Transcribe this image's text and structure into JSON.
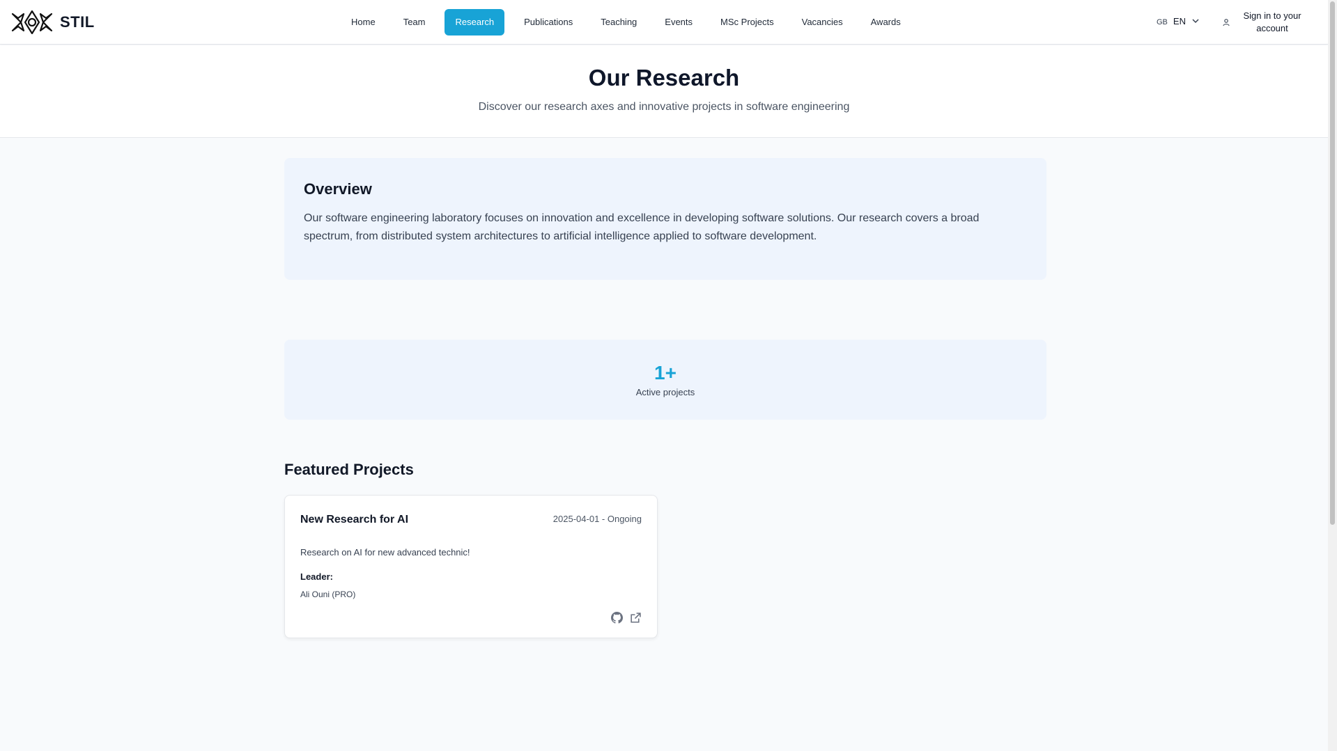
{
  "header": {
    "logo_text": "STIL",
    "nav": [
      {
        "label": "Home"
      },
      {
        "label": "Team"
      },
      {
        "label": "Research"
      },
      {
        "label": "Publications"
      },
      {
        "label": "Teaching"
      },
      {
        "label": "Events"
      },
      {
        "label": "MSc Projects"
      },
      {
        "label": "Vacancies"
      },
      {
        "label": "Awards"
      }
    ],
    "active_nav": "Research",
    "language": {
      "flag": "GB",
      "code": "EN"
    },
    "signin_label": "Sign in to your account"
  },
  "hero": {
    "title": "Our Research",
    "subtitle": "Discover our research axes and innovative projects in software engineering"
  },
  "overview": {
    "title": "Overview",
    "text": "Our software engineering laboratory focuses on innovation and excellence in developing software solutions. Our research covers a broad spectrum, from distributed system architectures to artificial intelligence applied to software development."
  },
  "stats": {
    "value": "1+",
    "label": "Active projects"
  },
  "featured": {
    "title": "Featured Projects",
    "projects": [
      {
        "title": "New Research for AI",
        "meta": "2025-04-01 - Ongoing",
        "description": "Research on AI for new advanced technic!",
        "leader_label": "Leader:",
        "leader": "Ali Ouni (PRO)",
        "icons": [
          "github-icon",
          "external-link-icon"
        ]
      }
    ]
  },
  "colors": {
    "accent": "#18a3d6",
    "card_bg": "#eef4fd",
    "page_bg": "#f8fafc"
  }
}
